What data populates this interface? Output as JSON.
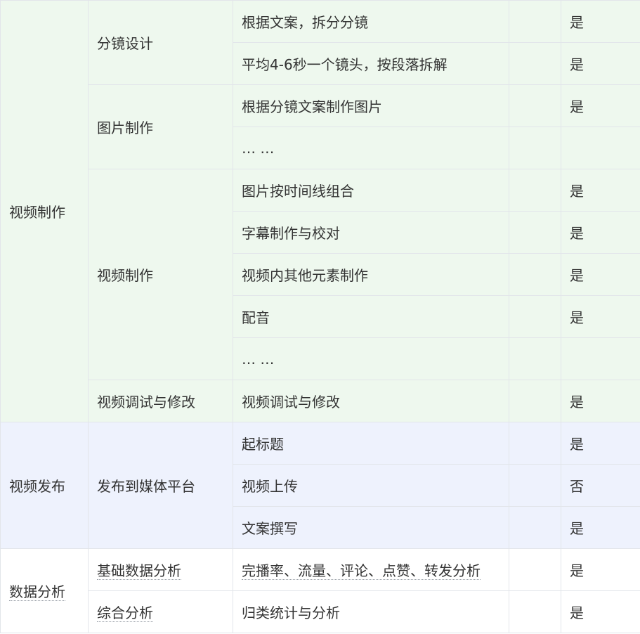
{
  "colors": {
    "section_video_production": "#eef8ee",
    "section_video_publish": "#eef2fd",
    "section_data_analysis": "#ffffff",
    "border": "#e2e5ea",
    "text": "#333333"
  },
  "sections": [
    {
      "title": "视频制作",
      "groups": [
        {
          "title": "分镜设计",
          "tasks": [
            {
              "text": "根据文案，拆分分镜",
              "note": "",
              "result": "是"
            },
            {
              "text": "平均4-6秒一个镜头，按段落拆解",
              "note": "",
              "result": "是"
            }
          ]
        },
        {
          "title": "图片制作",
          "tasks": [
            {
              "text": "根据分镜文案制作图片",
              "note": "",
              "result": "是"
            },
            {
              "text": "… …",
              "note": "",
              "result": ""
            }
          ]
        },
        {
          "title": "视频制作",
          "tasks": [
            {
              "text": "图片按时间线组合",
              "note": "",
              "result": "是"
            },
            {
              "text": "字幕制作与校对",
              "note": "",
              "result": "是"
            },
            {
              "text": "视频内其他元素制作",
              "note": "",
              "result": "是"
            },
            {
              "text": "配音",
              "note": "",
              "result": "是"
            },
            {
              "text": "… …",
              "note": "",
              "result": ""
            }
          ]
        },
        {
          "title": "视频调试与修改",
          "tasks": [
            {
              "text": "视频调试与修改",
              "note": "",
              "result": "是"
            }
          ]
        }
      ]
    },
    {
      "title": "视频发布",
      "groups": [
        {
          "title": "发布到媒体平台",
          "tasks": [
            {
              "text": "起标题",
              "note": "",
              "result": "是"
            },
            {
              "text": "视频上传",
              "note": "",
              "result": "否"
            },
            {
              "text": "文案撰写",
              "note": "",
              "result": "是"
            }
          ]
        }
      ]
    },
    {
      "title": "数据分析",
      "groups": [
        {
          "title": "基础数据分析",
          "tasks": [
            {
              "text": "完播率、流量、评论、点赞、转发分析",
              "note": "",
              "result": "是"
            }
          ]
        },
        {
          "title": "综合分析",
          "tasks": [
            {
              "text": "归类统计与分析",
              "note": "",
              "result": "是"
            }
          ]
        }
      ]
    }
  ]
}
